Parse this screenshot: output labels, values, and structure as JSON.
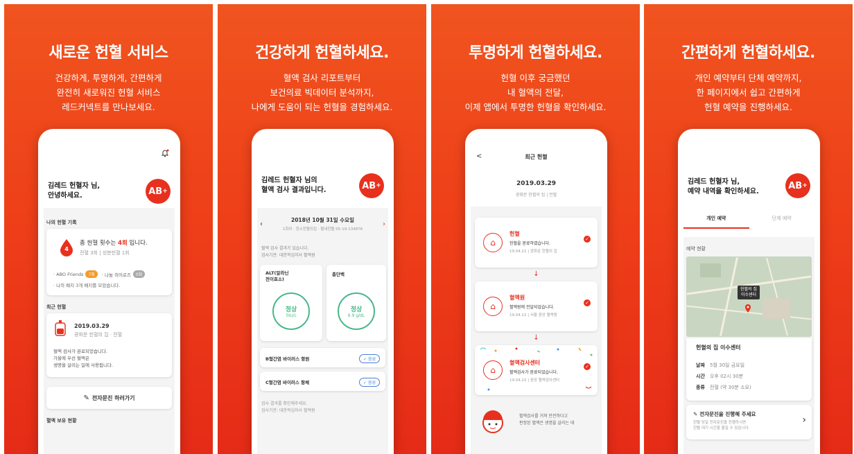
{
  "panels": [
    {
      "headline": "새로운 헌혈 서비스",
      "sub": [
        "건강하게, 투명하게, 간편하게",
        "완전히 새로워진 헌혈 서비스",
        "레드커넥트를 만나보세요."
      ],
      "screen": {
        "greeting": [
          "김레드 헌혈자 님,",
          "안녕하세요."
        ],
        "blood_type": "AB",
        "blood_sign": "+",
        "section_record": "나의 헌혈 기록",
        "drop_count": "4",
        "total_prefix": "총 헌혈 횟수는 ",
        "total_count": "4회",
        "total_suffix": " 입니다.",
        "breakdown": "전혈 3회  |  성분헌혈 1회",
        "friends_label": "· ABO Friends",
        "friends_tag": "7회",
        "share_label": "· 나눔 히어로즈",
        "share_tag": "0회",
        "badge_line": "· 나의 배지 3개 배지를 모았습니다.",
        "section_recent": "최근 헌혈",
        "recent_date": "2019.03.29",
        "recent_place": "광화문 헌혈의 집 · 전혈",
        "recent_desc": [
          "혈액 검사가 완료되었습니다.",
          "가을에 우선 혈액은",
          "생명을 살리는 일에 사용됩니다."
        ],
        "button_label": "전자문진 하러가기",
        "section_status": "혈액 보유 현황"
      }
    },
    {
      "headline": "건강하게 헌혈하세요.",
      "sub": [
        "혈액 검사 리포트부터",
        "보건의료 빅데이터 분석까지,",
        "나에게 도움이 되는 헌혈을 경험하세요."
      ],
      "screen": {
        "greeting": [
          "김레드 헌혈자 님의",
          "혈액 검사 결과입니다."
        ],
        "blood_type": "AB",
        "blood_sign": "+",
        "date_line": "2018년 10월 31일 수요일",
        "date_sub": "1회차 · 헌소헌혈의집 · 혈내헌혈 05-19-134876",
        "note": [
          "혈액 검사 결과가 있습니다.",
          "검사기관: 대한적십자사 혈액원"
        ],
        "alt_title": [
          "ALT(알라닌",
          "전이효소)"
        ],
        "alt_status": "정상",
        "alt_value": "5IU/L",
        "protein_title": "총단백",
        "protein_status": "정상",
        "protein_value": "6.9 g/dL",
        "hepb": "B형간염 바이러스 항원",
        "hepb_chip": "✓ 음성",
        "hepc": "C형간염 바이러스 항체",
        "hepc_chip": "✓ 음성",
        "footer": [
          "검사 결과를 확인해주세요.",
          "검사기관: 대한적십자사 혈액원"
        ]
      }
    },
    {
      "headline": "투명하게 헌혈하세요.",
      "sub": [
        "헌혈 이후 궁금했던",
        "내 혈액의 전달,",
        "이제 앱에서 투명한 헌혈을 확인하세요."
      ],
      "screen": {
        "back": "<",
        "title": "최근 헌혈",
        "date": "2019.03.29",
        "place": "광화문 헌혈의 집  |  전혈",
        "steps": [
          {
            "name": "헌혈",
            "desc": "헌혈을 완료하였습니다.",
            "meta": "19.04.22  |  광화문 헌혈의 집"
          },
          {
            "name": "혈액원",
            "desc": "혈액원에 전달되었습니다.",
            "meta": "19.04.22  |  서울 중앙 혈액원"
          },
          {
            "name": "혈액검사센터",
            "desc": "혈액검사가 완료되었습니다.",
            "meta": "19.04.22  |  중앙 혈액검사센터"
          }
        ],
        "mascot_text": [
          "혈액검사를 거쳐 안전하다고",
          "판정된 혈액은 생명을 살리는 데"
        ]
      }
    },
    {
      "headline": "간편하게 헌혈하세요.",
      "sub": [
        "개인 예약부터 단체 예약까지,",
        "한 페이지에서 쉽고 간편하게",
        "헌혈 예약을 진행하세요."
      ],
      "screen": {
        "greeting": [
          "김레드 헌혈자 님,",
          "예약 내역을 확인하세요."
        ],
        "blood_type": "AB",
        "blood_sign": "+",
        "tab_personal": "개인 예약",
        "tab_group": "단체 예약",
        "section_res": "예약 현황",
        "map_pin_label": [
          "헌혈의 집",
          "이수센터"
        ],
        "center_name": "헌혈의 집 이수센터",
        "rows": [
          {
            "k": "날짜",
            "v": "5월 30일 금요일"
          },
          {
            "k": "시간",
            "v": "오후 02시 30분"
          },
          {
            "k": "종류",
            "v": "전혈 (약 30분 소요)"
          }
        ],
        "esign_title": "전자문진을 진행해 주세요",
        "esign_desc": [
          "헌혈 당일 전자문진을 진행하시면",
          "헌혈 대기 시간을 줄일 수 있습니다."
        ],
        "esign_arrow": "›"
      }
    }
  ],
  "colors": {
    "accent": "#e8301e",
    "orange": "#f0541f",
    "healthy": "#46b889"
  }
}
